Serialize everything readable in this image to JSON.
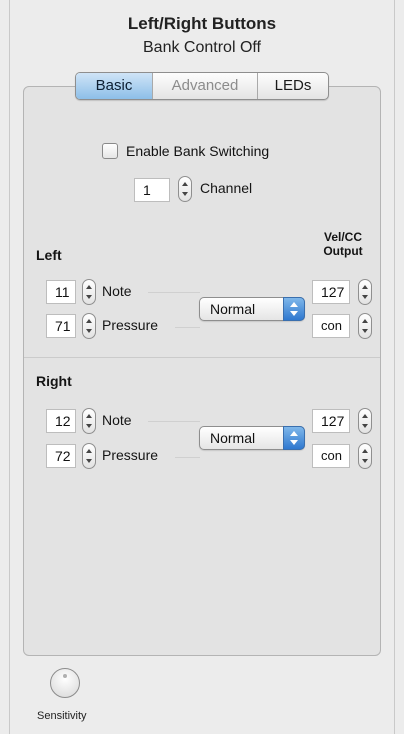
{
  "header": {
    "title": "Left/Right Buttons",
    "subtitle": "Bank Control Off"
  },
  "tabs": [
    {
      "label": "Basic",
      "state": "selected"
    },
    {
      "label": "Advanced",
      "state": "disabled"
    },
    {
      "label": "LEDs",
      "state": "normal"
    }
  ],
  "bank": {
    "enable_label": "Enable Bank Switching",
    "enable_checked": false,
    "channel_value": "1",
    "channel_label": "Channel"
  },
  "vel_cc_header": {
    "line1": "Vel/CC",
    "line2": "Output"
  },
  "left": {
    "title": "Left",
    "note_value": "11",
    "note_label": "Note",
    "pressure_value": "71",
    "pressure_label": "Pressure",
    "mode": "Normal",
    "vel_value": "127",
    "cc_value": "con"
  },
  "right": {
    "title": "Right",
    "note_value": "12",
    "note_label": "Note",
    "pressure_value": "72",
    "pressure_label": "Pressure",
    "mode": "Normal",
    "vel_value": "127",
    "cc_value": "con"
  },
  "sensitivity": {
    "label": "Sensitivity"
  },
  "colors": {
    "accent": "#3a83d6",
    "tab_selected": "#9ec9ee",
    "background": "#ececec"
  }
}
